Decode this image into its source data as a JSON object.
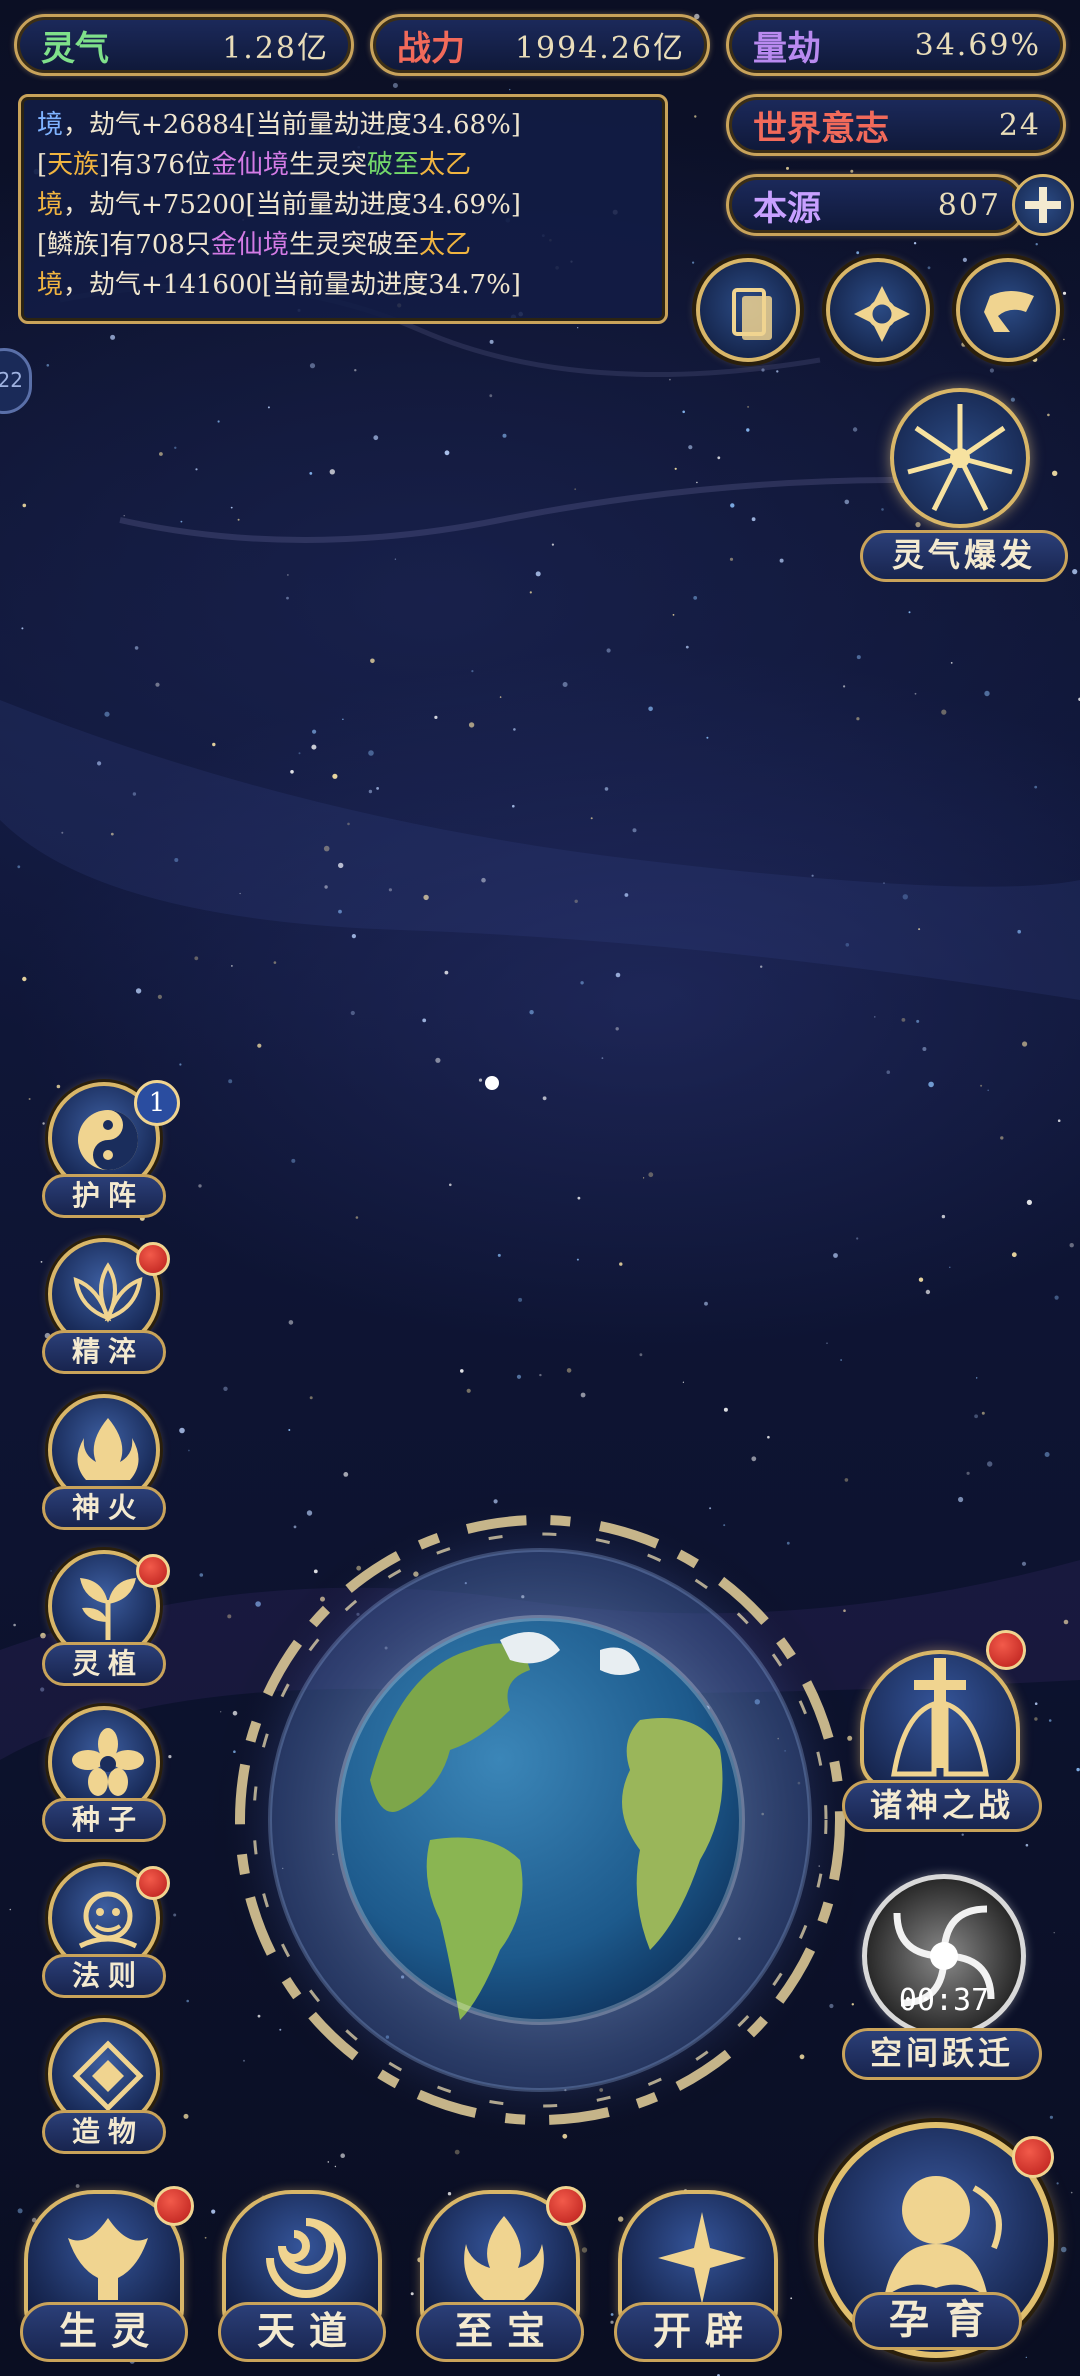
{
  "stats": {
    "lingqi": {
      "label": "灵气",
      "value": "1.28亿"
    },
    "zhanli": {
      "label": "战力",
      "value": "1994.26亿"
    },
    "liangjie": {
      "label": "量劫",
      "value": "34.69%"
    },
    "shijie": {
      "label": "世界意志",
      "value": "24"
    },
    "benyuan": {
      "label": "本源",
      "value": "807"
    }
  },
  "log": {
    "line1": {
      "a": "境",
      "b": "，劫气+26884[当前量劫进度34.68%]"
    },
    "line2": {
      "a": "[",
      "b": "天族",
      "c": "]有376位",
      "d": "金仙境",
      "e": "生灵突",
      "f": "破至",
      "g": "太乙"
    },
    "line3": {
      "a": "境",
      "b": "，劫气+75200[当前量劫进度34.69%]"
    },
    "line4": {
      "a": "[鳞族]有708只",
      "b": "金仙境",
      "c": "生灵突破至",
      "d": "太乙"
    },
    "line5": {
      "a": "境",
      "b": "，劫气+141600[当前量劫进度34.7%]"
    }
  },
  "side_tab": "22",
  "burst": {
    "label": "灵气爆发"
  },
  "left_menu": [
    {
      "label": "护阵",
      "badge": "1"
    },
    {
      "label": "精淬"
    },
    {
      "label": "神火"
    },
    {
      "label": "灵植"
    },
    {
      "label": "种子"
    },
    {
      "label": "法则"
    },
    {
      "label": "造物"
    }
  ],
  "right_menu": {
    "war": {
      "label": "诸神之战"
    },
    "jump": {
      "label": "空间跃迁",
      "timer": "00:37"
    }
  },
  "bottom_menu": [
    {
      "label": "生灵"
    },
    {
      "label": "天道"
    },
    {
      "label": "至宝"
    },
    {
      "label": "开辟"
    }
  ],
  "nurture": {
    "label": "孕育"
  },
  "colors": {
    "gold": "#c9a35a",
    "red_dot": "#d8322a",
    "panel": "#12204a"
  },
  "icons": [
    "cards-icon",
    "portal-icon",
    "scroll-icon",
    "plus-icon",
    "sunburst-icon",
    "yin-yang-icon",
    "lotus-icon",
    "flame-icon",
    "plant-icon",
    "flower-icon",
    "beast-icon",
    "diamond-icon",
    "sword-icon",
    "vortex-icon",
    "phoenix-icon",
    "swirl-icon",
    "treasure-icon",
    "spark-icon",
    "figure-icon",
    "earth-icon"
  ]
}
